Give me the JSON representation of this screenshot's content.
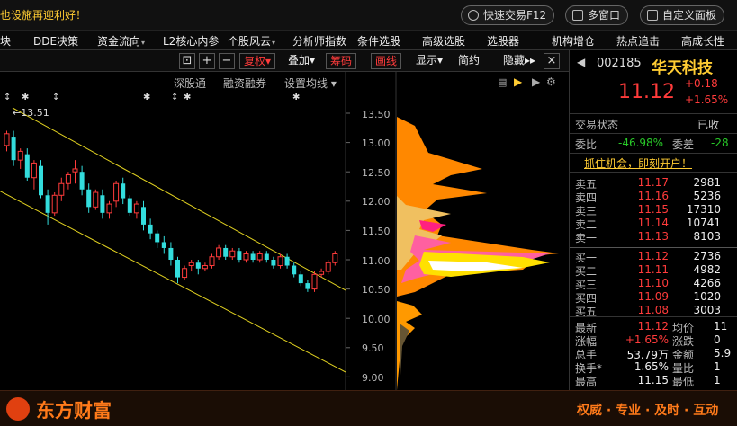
{
  "topbar": {
    "notice": "也设施再迎利好！",
    "quick_trade": "快速交易F12",
    "multi_window": "多窗口",
    "custom_panel": "自定义面板"
  },
  "nav": [
    "板块",
    "DDE决策",
    "资金流向",
    "L2核心内参",
    "个股风云",
    "分析师指数",
    "条件选股",
    "高级选股",
    "选股器",
    "机构增仓",
    "热点追击",
    "高成长性"
  ],
  "toolbar": {
    "fuquan": "复权",
    "diejia": "叠加",
    "chouma": "筹码",
    "huaxian": "画线",
    "xianshi": "显示",
    "jianyue": "简约",
    "yincang": "隐藏"
  },
  "subtools": {
    "shengutong": "深股通",
    "rongzi": "融资融券",
    "junxian": "设置均线"
  },
  "chart_data": {
    "type": "candlestick",
    "price_axis": [
      "13.50",
      "13.00",
      "12.50",
      "12.00",
      "11.50",
      "11.00",
      "10.50",
      "10.00",
      "9.50",
      "9.00"
    ],
    "high_marker": "13.51",
    "candles": [
      [
        12.95,
        13.15,
        12.85,
        13.2,
        "up"
      ],
      [
        13.1,
        12.7,
        12.6,
        13.2,
        "down"
      ],
      [
        12.7,
        12.85,
        12.55,
        12.9,
        "up"
      ],
      [
        12.8,
        12.4,
        12.35,
        12.9,
        "down"
      ],
      [
        12.4,
        12.65,
        12.2,
        12.7,
        "up"
      ],
      [
        12.6,
        12.1,
        12.05,
        12.7,
        "down"
      ],
      [
        12.1,
        11.8,
        11.6,
        12.2,
        "down"
      ],
      [
        11.8,
        12.1,
        11.75,
        12.15,
        "up"
      ],
      [
        12.1,
        12.3,
        12.0,
        12.4,
        "up"
      ],
      [
        12.3,
        12.45,
        12.2,
        12.5,
        "up"
      ],
      [
        12.5,
        12.55,
        12.3,
        12.7,
        "up"
      ],
      [
        12.5,
        12.2,
        12.1,
        12.6,
        "down"
      ],
      [
        12.2,
        11.9,
        11.8,
        12.3,
        "down"
      ],
      [
        11.9,
        12.15,
        11.85,
        12.2,
        "up"
      ],
      [
        12.1,
        11.8,
        11.7,
        12.2,
        "down"
      ],
      [
        11.8,
        11.95,
        11.7,
        12.0,
        "up"
      ],
      [
        12.0,
        12.3,
        11.9,
        12.35,
        "up"
      ],
      [
        12.3,
        12.05,
        11.95,
        12.4,
        "down"
      ],
      [
        12.05,
        11.8,
        11.75,
        12.1,
        "down"
      ],
      [
        11.8,
        11.95,
        11.7,
        12.0,
        "up"
      ],
      [
        11.9,
        11.6,
        11.5,
        12.0,
        "down"
      ],
      [
        11.6,
        11.45,
        11.35,
        11.7,
        "down"
      ],
      [
        11.45,
        11.3,
        11.2,
        11.5,
        "down"
      ],
      [
        11.3,
        11.2,
        11.1,
        11.4,
        "down"
      ],
      [
        11.2,
        11.0,
        10.9,
        11.3,
        "down"
      ],
      [
        11.0,
        10.7,
        10.6,
        11.05,
        "down"
      ],
      [
        10.7,
        10.85,
        10.65,
        10.9,
        "up"
      ],
      [
        10.9,
        10.95,
        10.8,
        11.0,
        "up"
      ],
      [
        10.95,
        10.85,
        10.75,
        11.0,
        "down"
      ],
      [
        10.85,
        10.9,
        10.8,
        10.95,
        "up"
      ],
      [
        10.9,
        11.05,
        10.85,
        11.1,
        "up"
      ],
      [
        11.05,
        11.2,
        11.0,
        11.25,
        "up"
      ],
      [
        11.2,
        11.05,
        11.0,
        11.25,
        "down"
      ],
      [
        11.05,
        11.15,
        11.0,
        11.2,
        "up"
      ],
      [
        11.15,
        11.0,
        10.95,
        11.2,
        "down"
      ],
      [
        11.0,
        11.1,
        10.95,
        11.15,
        "up"
      ],
      [
        11.1,
        11.0,
        10.95,
        11.15,
        "down"
      ],
      [
        11.0,
        11.1,
        10.95,
        11.15,
        "up"
      ],
      [
        11.1,
        11.0,
        10.95,
        11.15,
        "down"
      ],
      [
        11.0,
        10.9,
        10.85,
        11.05,
        "down"
      ],
      [
        10.9,
        11.05,
        10.85,
        11.1,
        "up"
      ],
      [
        11.05,
        10.9,
        10.85,
        11.1,
        "down"
      ],
      [
        10.9,
        10.75,
        10.7,
        10.95,
        "down"
      ],
      [
        10.75,
        10.6,
        10.55,
        10.8,
        "down"
      ],
      [
        10.6,
        10.5,
        10.45,
        10.65,
        "down"
      ],
      [
        10.5,
        10.75,
        10.45,
        10.8,
        "up"
      ],
      [
        10.75,
        10.8,
        10.7,
        10.85,
        "up"
      ],
      [
        10.8,
        10.95,
        10.75,
        11.0,
        "up"
      ],
      [
        10.95,
        11.1,
        10.9,
        11.15,
        "up"
      ]
    ]
  },
  "stock": {
    "code": "002185",
    "name": "华天科技",
    "price": "11.12",
    "change": "+0.18",
    "change_pct": "+1.65%",
    "status_label": "交易状态",
    "status_value": "已收",
    "wb_label": "委比",
    "wb_value": "-46.98%",
    "wc_label": "委差",
    "wc_value": "-28",
    "banner": "抓住机会，即刻开户！"
  },
  "asks": [
    {
      "label": "卖五",
      "price": "11.17",
      "vol": "2981"
    },
    {
      "label": "卖四",
      "price": "11.16",
      "vol": "5236"
    },
    {
      "label": "卖三",
      "price": "11.15",
      "vol": "17310"
    },
    {
      "label": "卖二",
      "price": "11.14",
      "vol": "10741"
    },
    {
      "label": "卖一",
      "price": "11.13",
      "vol": "8103"
    }
  ],
  "bids": [
    {
      "label": "买一",
      "price": "11.12",
      "vol": "2736"
    },
    {
      "label": "买二",
      "price": "11.11",
      "vol": "4982"
    },
    {
      "label": "买三",
      "price": "11.10",
      "vol": "4266"
    },
    {
      "label": "买四",
      "price": "11.09",
      "vol": "1020"
    },
    {
      "label": "买五",
      "price": "11.08",
      "vol": "3003"
    }
  ],
  "stats": [
    {
      "l1": "最新",
      "v1": "11.12",
      "l2": "均价",
      "v2": "11"
    },
    {
      "l1": "涨幅",
      "v1": "+1.65%",
      "l2": "涨跌",
      "v2": "0"
    },
    {
      "l1": "总手",
      "v1": "53.79万",
      "l2": "金额",
      "v2": "5.9"
    },
    {
      "l1": "换手*",
      "v1": "1.65%",
      "l2": "量比",
      "v2": "1"
    },
    {
      "l1": "最高",
      "v1": "11.15",
      "l2": "最低",
      "v2": "1"
    }
  ],
  "footer": {
    "brand": "东方财富",
    "slogan": "权威 · 专业 · 及时 · 互动"
  }
}
